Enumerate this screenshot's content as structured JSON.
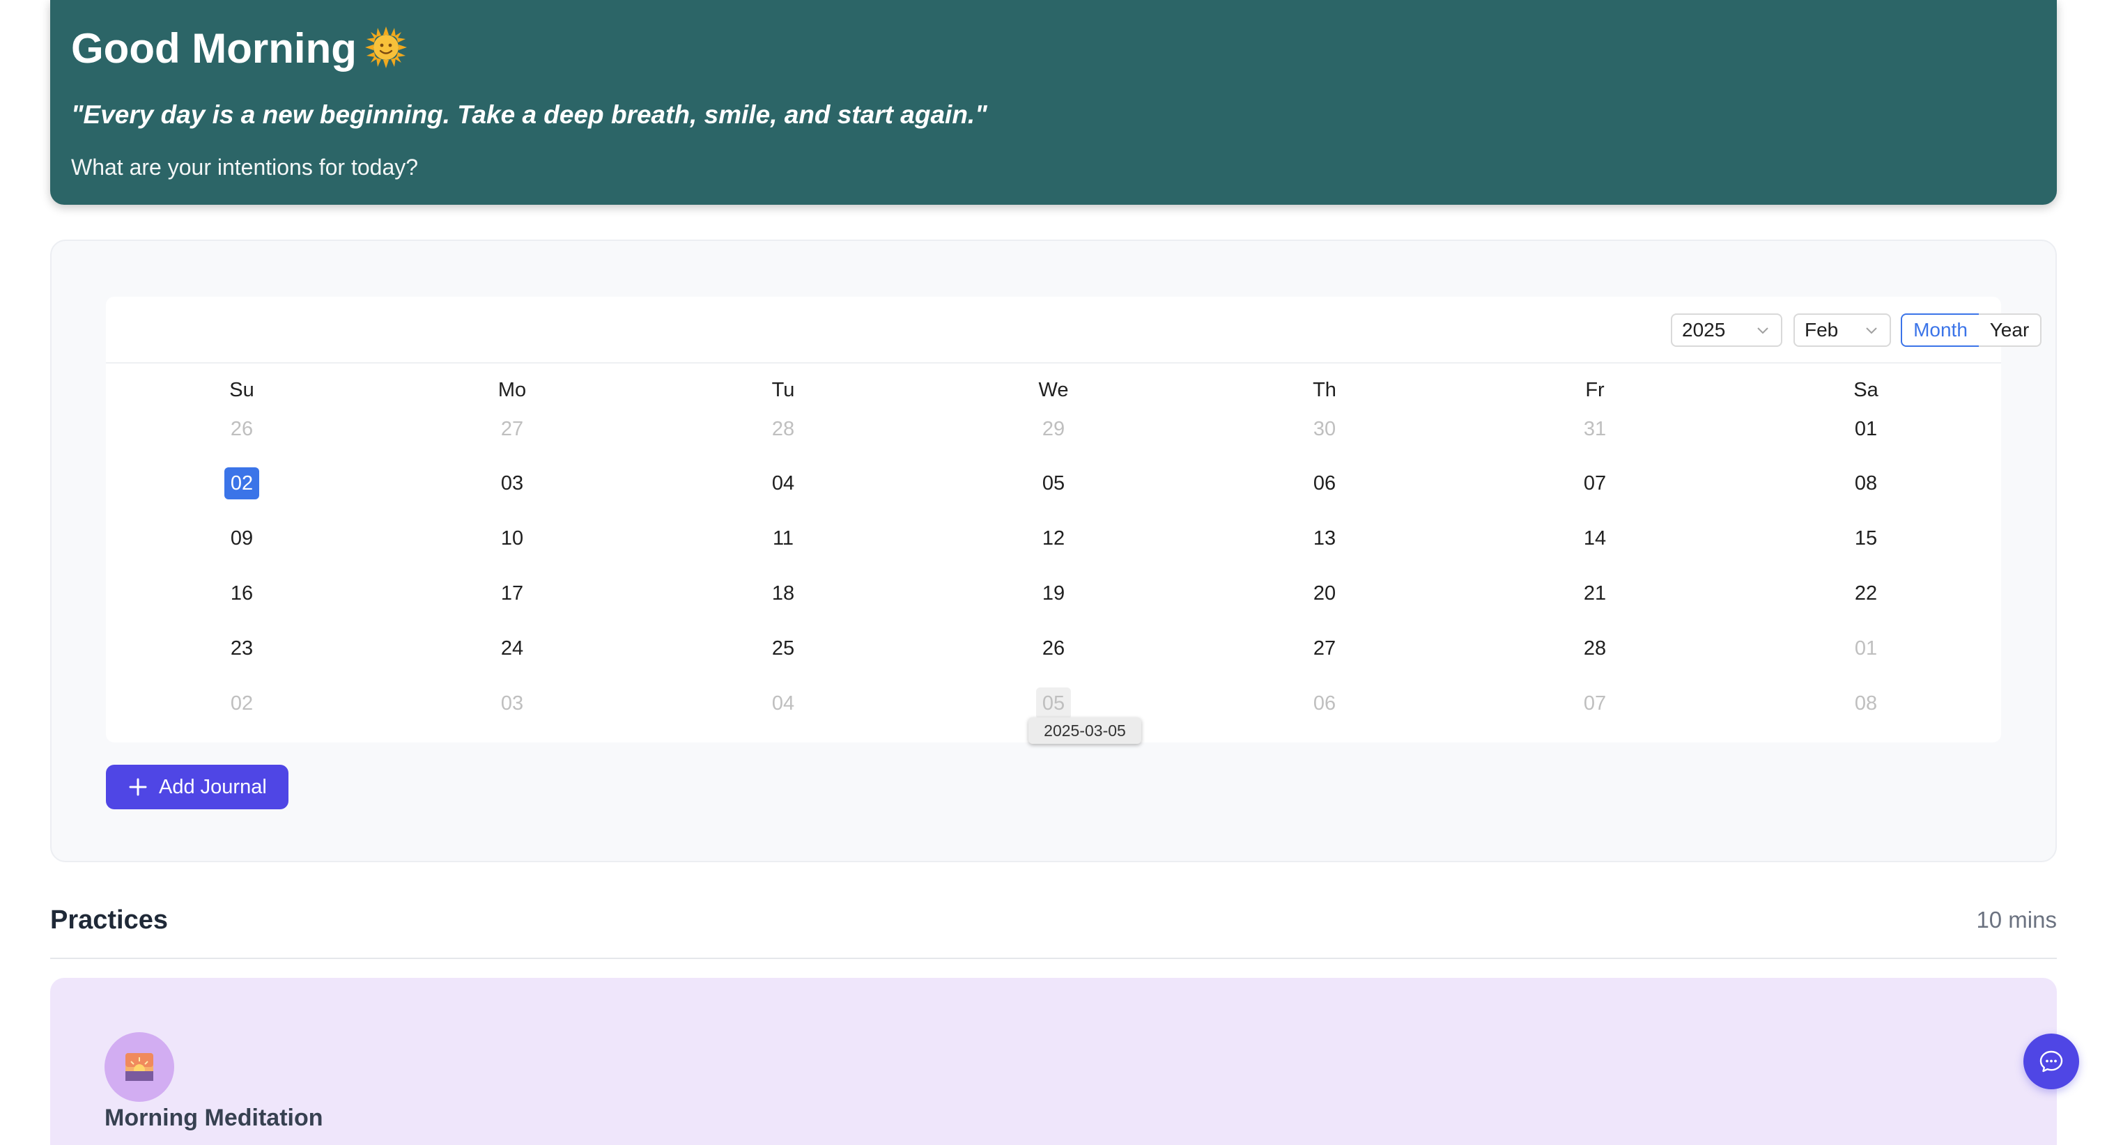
{
  "greeting": {
    "title": "Good Morning",
    "quote": "\"Every day is a new beginning. Take a deep breath, smile, and start again.\"",
    "prompt": "What are your intentions for today?"
  },
  "calendar": {
    "year_select": "2025",
    "month_select": "Feb",
    "mode_month": "Month",
    "mode_year": "Year",
    "selected_mode": "Month",
    "weekdays": [
      "Su",
      "Mo",
      "Tu",
      "We",
      "Th",
      "Fr",
      "Sa"
    ],
    "weeks": [
      [
        "26",
        "27",
        "28",
        "29",
        "30",
        "31",
        "01"
      ],
      [
        "02",
        "03",
        "04",
        "05",
        "06",
        "07",
        "08"
      ],
      [
        "09",
        "10",
        "11",
        "12",
        "13",
        "14",
        "15"
      ],
      [
        "16",
        "17",
        "18",
        "19",
        "20",
        "21",
        "22"
      ],
      [
        "23",
        "24",
        "25",
        "26",
        "27",
        "28",
        "01"
      ],
      [
        "02",
        "03",
        "04",
        "05",
        "06",
        "07",
        "08"
      ]
    ],
    "selected_date": "02",
    "hovered_date": "05",
    "tooltip": "2025-03-05",
    "accent_color": "#3b74e8"
  },
  "actions": {
    "add_journal": "Add Journal"
  },
  "practices": {
    "title": "Practices",
    "duration": "10 mins",
    "items": [
      {
        "name": "Morning Meditation",
        "icon": "sunrise-icon"
      }
    ]
  },
  "colors": {
    "hero_bg": "#2c6567",
    "primary_button": "#4f46e5",
    "practice_card_bg": "#efe6fb"
  }
}
